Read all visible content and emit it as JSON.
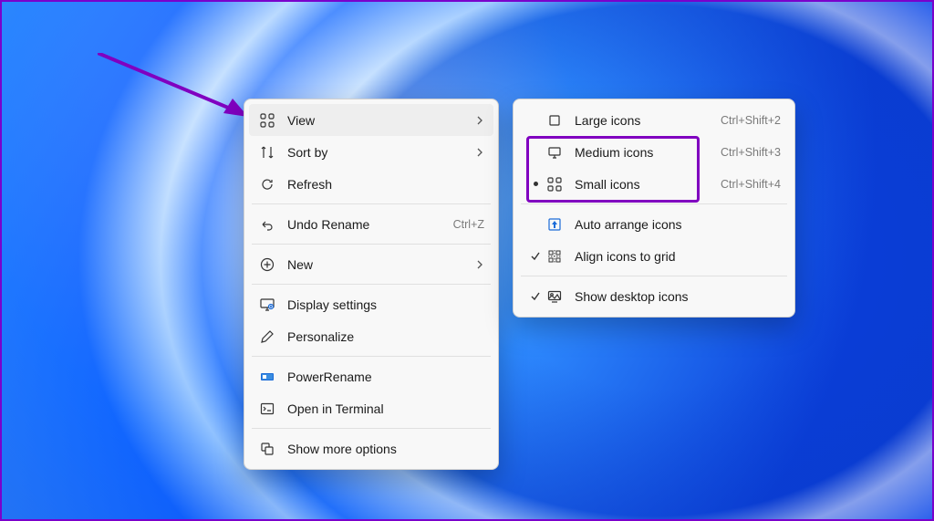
{
  "menu1": {
    "view": "View",
    "sortby": "Sort by",
    "refresh": "Refresh",
    "undo": "Undo Rename",
    "undo_kb": "Ctrl+Z",
    "new": "New",
    "display": "Display settings",
    "personalize": "Personalize",
    "powerrename": "PowerRename",
    "terminal": "Open in Terminal",
    "more": "Show more options"
  },
  "menu2": {
    "large": "Large icons",
    "large_kb": "Ctrl+Shift+2",
    "medium": "Medium icons",
    "medium_kb": "Ctrl+Shift+3",
    "small": "Small icons",
    "small_kb": "Ctrl+Shift+4",
    "auto": "Auto arrange icons",
    "align": "Align icons to grid",
    "show": "Show desktop icons"
  }
}
